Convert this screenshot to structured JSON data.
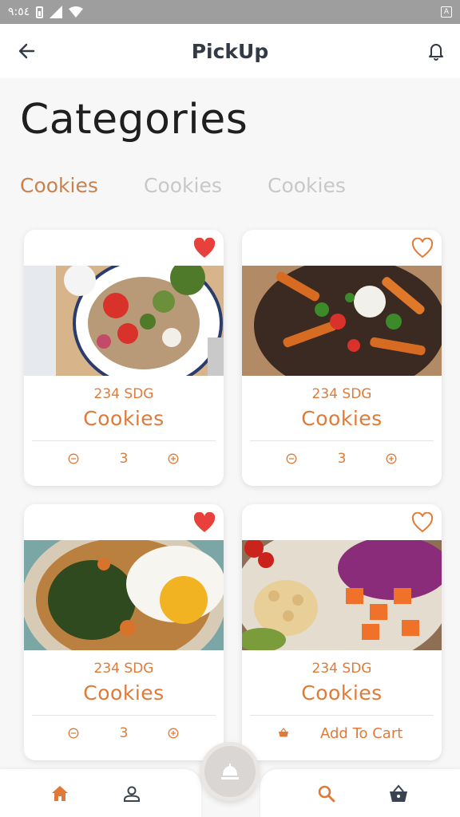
{
  "status_bar": {
    "time": "٩:٥٤",
    "icons": [
      "battery-charging-icon",
      "signal-icon",
      "wifi-icon",
      "keyboard-a-icon"
    ],
    "indicator_letter": "A"
  },
  "app_bar": {
    "title": "PickUp",
    "back_icon": "arrow-left-icon",
    "notification_icon": "bell-icon"
  },
  "page": {
    "heading": "Categories"
  },
  "tabs": [
    {
      "label": "Cookies",
      "active": true
    },
    {
      "label": "Cookies",
      "active": false
    },
    {
      "label": "Cookies",
      "active": false
    }
  ],
  "colors": {
    "accent": "#e07a38",
    "tab_active": "#c8824f",
    "tab_inactive": "#c8c8c8",
    "heart_filled": "#e8403a",
    "background": "#f7f7f7"
  },
  "products": [
    {
      "price": "234 SDG",
      "name": "Cookies",
      "favorite": true,
      "quantity": "3",
      "action": "quantity",
      "image": "salad-bowl-photo"
    },
    {
      "price": "234 SDG",
      "name": "Cookies",
      "favorite": false,
      "quantity": "3",
      "action": "quantity",
      "image": "sweet-potato-fries-photo"
    },
    {
      "price": "234 SDG",
      "name": "Cookies",
      "favorite": true,
      "quantity": "3",
      "action": "quantity",
      "image": "fried-egg-plate-photo"
    },
    {
      "price": "234 SDG",
      "name": "Cookies",
      "favorite": false,
      "action": "cart",
      "cart_label": "Add To Cart",
      "image": "chickpea-bowl-photo"
    }
  ],
  "bottom_nav": {
    "items": [
      "home-icon",
      "profile-icon",
      "search-icon",
      "basket-icon"
    ],
    "fab_icon": "food-cloche-icon"
  }
}
